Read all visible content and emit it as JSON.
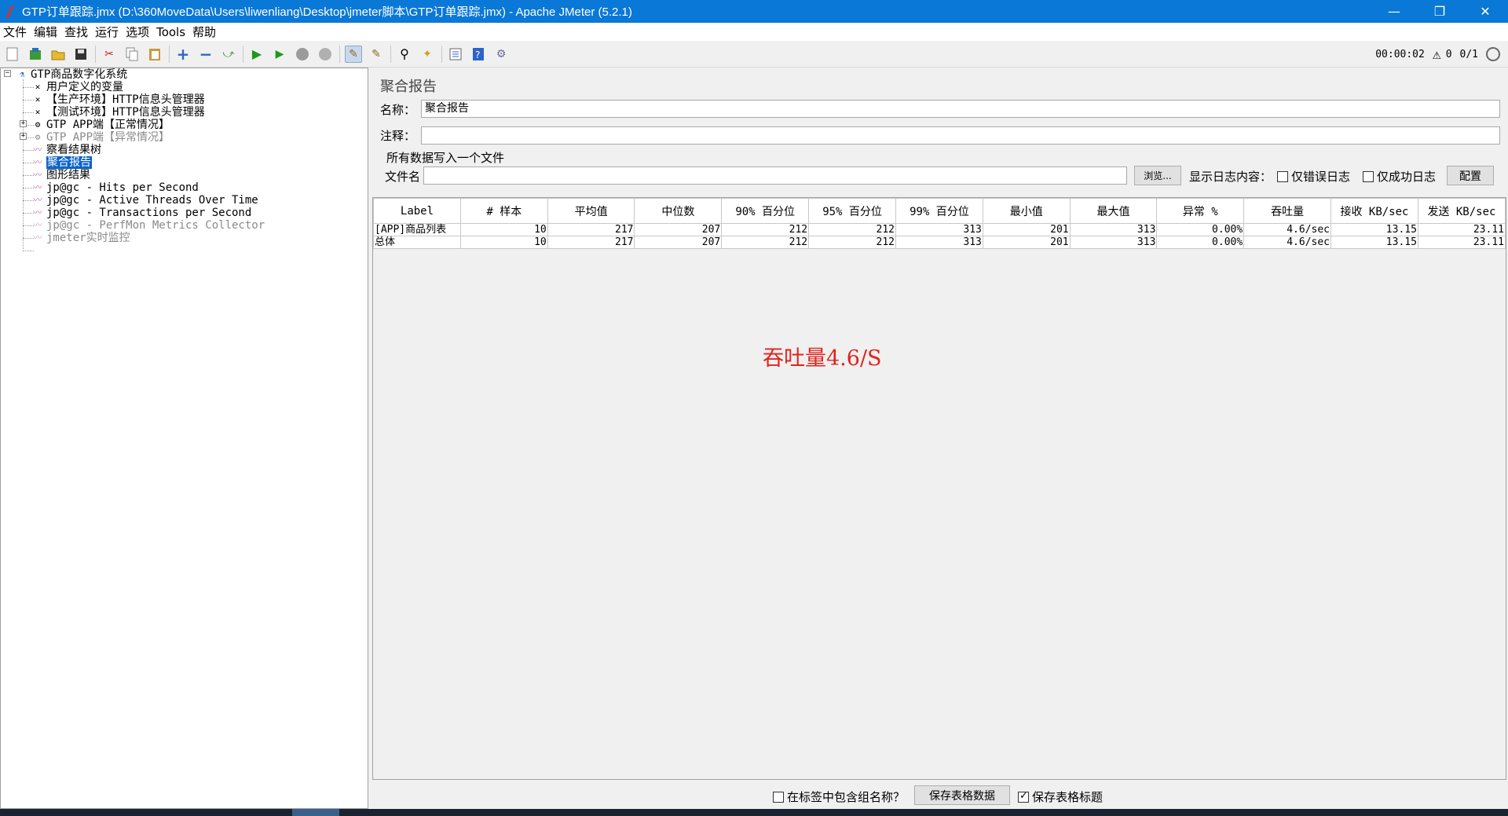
{
  "window": {
    "title": "GTP订单跟踪.jmx (D:\\360MoveData\\Users\\liwenliang\\Desktop\\jmeter脚本\\GTP订单跟踪.jmx) - Apache JMeter (5.2.1)",
    "minimize": "—",
    "restore": "❐",
    "close": "✕"
  },
  "menu": [
    "文件",
    "编辑",
    "查找",
    "运行",
    "选项",
    "Tools",
    "帮助"
  ],
  "toolbar": {
    "timer": "00:00:02",
    "warn_icon": "⚠",
    "warn_count": "0",
    "threads": "0/1"
  },
  "tree": {
    "root": "GTP商品数字化系统",
    "items": [
      {
        "label": "用户定义的变量",
        "icon": "wrench-icon"
      },
      {
        "label": "【生产环境】HTTP信息头管理器",
        "icon": "wrench-icon"
      },
      {
        "label": "【测试环境】HTTP信息头管理器",
        "icon": "wrench-icon"
      },
      {
        "label": "GTP APP端【正常情况】",
        "icon": "gear-icon"
      },
      {
        "label": "GTP APP端【异常情况】",
        "icon": "gear-icon"
      },
      {
        "label": "察看结果树",
        "icon": "chart-icon"
      },
      {
        "label": "聚合报告",
        "icon": "chart-icon"
      },
      {
        "label": "图形结果",
        "icon": "chart-icon"
      },
      {
        "label": "jp@gc - Hits per Second",
        "icon": "chart-icon"
      },
      {
        "label": "jp@gc - Active Threads Over Time",
        "icon": "chart-icon"
      },
      {
        "label": "jp@gc - Transactions per Second",
        "icon": "chart-icon"
      },
      {
        "label": "jp@gc - PerfMon Metrics Collector",
        "icon": "chart-icon"
      },
      {
        "label": "jmeter实时监控",
        "icon": "chart-icon"
      }
    ]
  },
  "main": {
    "title": "聚合报告",
    "name_label": "名称：",
    "name_value": "聚合报告",
    "comment_label": "注释：",
    "comment_value": "",
    "file_group_title": "所有数据写入一个文件",
    "filename_label": "文件名",
    "filename_value": "",
    "browse_button": "浏览...",
    "log_content_label": "显示日志内容：",
    "errors_only_label": "仅错误日志",
    "success_only_label": "仅成功日志",
    "configure_button": "配置"
  },
  "table": {
    "headers": [
      "Label",
      "# 样本",
      "平均值",
      "中位数",
      "90% 百分位",
      "95% 百分位",
      "99% 百分位",
      "最小值",
      "最大值",
      "异常 %",
      "吞吐量",
      "接收 KB/sec",
      "发送 KB/sec"
    ],
    "rows": [
      [
        "[APP]商品列表",
        "10",
        "217",
        "207",
        "212",
        "212",
        "313",
        "201",
        "313",
        "0.00%",
        "4.6/sec",
        "13.15",
        "23.11"
      ],
      [
        "总体",
        "10",
        "217",
        "207",
        "212",
        "212",
        "313",
        "201",
        "313",
        "0.00%",
        "4.6/sec",
        "13.15",
        "23.11"
      ]
    ]
  },
  "annotation": "吞吐量4.6/S",
  "bottom": {
    "include_group_label": "在标签中包含组名称？",
    "save_table_button": "保存表格数据",
    "save_header_label": "保存表格标题"
  }
}
